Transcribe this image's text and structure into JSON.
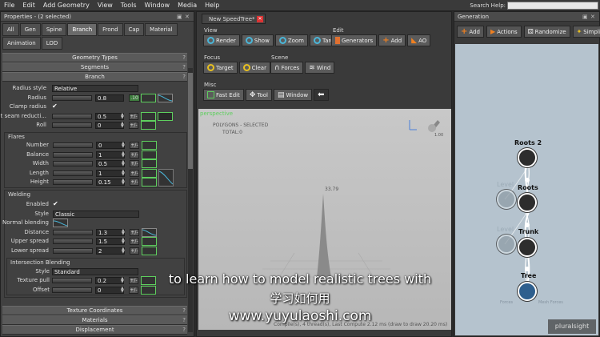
{
  "menubar": {
    "items": [
      "File",
      "Edit",
      "Add Geometry",
      "View",
      "Tools",
      "Window",
      "Media",
      "Help"
    ],
    "search_help_label": "Search Help:"
  },
  "properties": {
    "title": "Properties - (2 selected)",
    "tabs": [
      "All",
      "Gen",
      "Spine",
      "Branch",
      "Frond",
      "Cap",
      "Material",
      "Animation",
      "LOD"
    ],
    "active_tab": "Branch",
    "sections_top": [
      "Geometry Types",
      "Segments",
      "Branch"
    ],
    "branch_rows": [
      {
        "label": "Radius style",
        "type": "drop",
        "value": "Relative"
      },
      {
        "label": "Radius",
        "type": "num",
        "value": "0.8",
        "extra": ".10"
      },
      {
        "label": "Clamp radius",
        "type": "check",
        "value": "✔"
      },
      {
        "label": "Light seam reducti...",
        "type": "num",
        "value": "0.5"
      },
      {
        "label": "Roll",
        "type": "num",
        "value": "0"
      }
    ],
    "flares": {
      "title": "Flares",
      "rows": [
        {
          "label": "Number",
          "value": "0"
        },
        {
          "label": "Balance",
          "value": "1"
        },
        {
          "label": "Width",
          "value": "0.5"
        },
        {
          "label": "Length",
          "value": "1"
        },
        {
          "label": "Height",
          "value": "0.15"
        }
      ]
    },
    "welding": {
      "title": "Welding",
      "rows": [
        {
          "label": "Enabled",
          "type": "check",
          "value": "✔"
        },
        {
          "label": "Style",
          "type": "drop",
          "value": "Classic"
        },
        {
          "label": "Normal blending",
          "type": "curve",
          "value": ""
        },
        {
          "label": "Distance",
          "type": "num",
          "value": "1.3"
        },
        {
          "label": "Upper spread",
          "type": "num",
          "value": "1.5"
        },
        {
          "label": "Lower spread",
          "type": "num",
          "value": "2"
        }
      ]
    },
    "intersection": {
      "title": "Intersection Blending",
      "rows": [
        {
          "label": "Style",
          "type": "drop",
          "value": "Standard"
        },
        {
          "label": "Texture pull",
          "type": "num",
          "value": "0.2"
        },
        {
          "label": "Offset",
          "type": "num",
          "value": "0"
        }
      ]
    },
    "sections_bottom": [
      "Texture Coordinates",
      "Materials",
      "Displacement"
    ]
  },
  "editor": {
    "tab_title": "New SpeedTree*",
    "view_label": "View",
    "view_buttons": [
      "Render",
      "Show",
      "Zoom",
      "Target"
    ],
    "edit_label": "Edit",
    "edit_buttons": [
      "Generators",
      "Add",
      "AO"
    ],
    "focus_label": "Focus",
    "focus_buttons": [
      "Target",
      "Clear"
    ],
    "scene_label": "Scene",
    "scene_buttons": [
      "Forces",
      "Wind"
    ],
    "misc_label": "Misc",
    "misc_buttons": [
      "Fast Edit",
      "Tool",
      "Window"
    ]
  },
  "viewport": {
    "label": "perspective",
    "polygons_label": "POLYGONS - SELECTED",
    "total_label": "TOTAL:",
    "total_value": "0",
    "height_marker": "33.79",
    "zoom_value": "1.00",
    "status_text": "Compile(s), 4 thread(s), Last Compute 2.12 ms (draw to draw 20.20 ms)"
  },
  "generation": {
    "title": "Generation",
    "buttons": [
      "Add",
      "Actions",
      "Randomize",
      "Simplify"
    ],
    "nodes": [
      "Roots 2",
      "Roots",
      "Trunk",
      "Tree"
    ],
    "ghost_labels": [
      "Level",
      "Level"
    ],
    "bottom_labels": [
      "Forces",
      "Mesh Forces"
    ]
  },
  "subtitles": {
    "line1": "to learn how to model realistic trees with",
    "line2": "学习如何用",
    "line3": "www.yuyulaoshi.com"
  },
  "watermark": "pluralsight",
  "colors": {
    "accent_green": "#5ecf5e",
    "accent_cyan": "#4ab6d9",
    "panel_bg": "#414141",
    "viewport_bg": "#c0c0c0",
    "generation_bg": "#b5c3ce"
  }
}
